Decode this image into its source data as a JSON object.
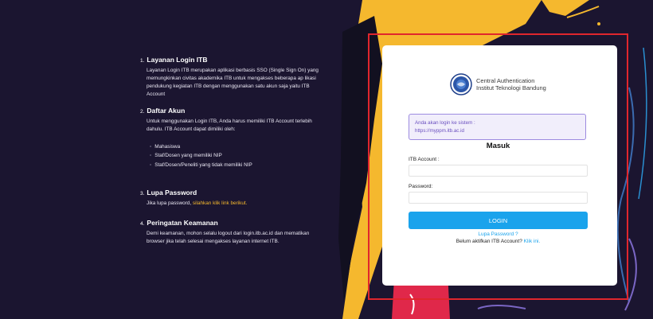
{
  "info": {
    "sections": [
      {
        "number": "1.",
        "title": "Layanan Login ITB",
        "body": "Layanan Login ITB merupakan aplikasi berbasis SSO (Single Sign On) yang memungkinkan civitas akademika ITB untuk mengakses beberapa ap likasi pendukung kegiatan ITB dengan menggunakan satu akun saja yaitu ITB Account"
      },
      {
        "number": "2.",
        "title": "Daftar Akun",
        "body": "Untuk menggunakan Login ITB, Anda harus memiliki ITB Account terlebih dahulu. ITB Account dapat dimiliki oleh:",
        "items": [
          "Mahasiswa",
          "Staf/Dosen yang memiliki NIP",
          "Staf/Dosen/Peneliti yang tidak memiliki NIP"
        ]
      },
      {
        "number": "3.",
        "title": "Lupa Password",
        "body_prefix": "Jika lupa password,",
        "body_link": "silahkan klik link berikut."
      },
      {
        "number": "4.",
        "title": "Peringatan Keamanan",
        "body": "Demi keamanan, mohon selalu logout dari login.itb.ac.id dan mematikan browser jika telah selesai mengakses layanan internet ITB."
      }
    ]
  },
  "card": {
    "brand_line1": "Central Authentication",
    "brand_line2": "Institut Teknologi Bandung",
    "notice_line1": "Anda akan login ke sistem :",
    "notice_line2": "https://myppm.itb.ac.id",
    "form_title": "Masuk",
    "account_label": "ITB Account :",
    "password_label": "Password:",
    "account_value": "",
    "password_value": "",
    "login_label": "LOGIN",
    "forgot_label": "Lupa Password ?",
    "activate_text": "Belum aktifkan ITB Account?",
    "activate_link": "Klik ini."
  },
  "colors": {
    "background": "#1b1530",
    "accent_yellow": "#f5b82e",
    "accent_red": "#e0262d",
    "button_blue": "#1aa3ec",
    "notice_purple": "#6a4fbf"
  }
}
